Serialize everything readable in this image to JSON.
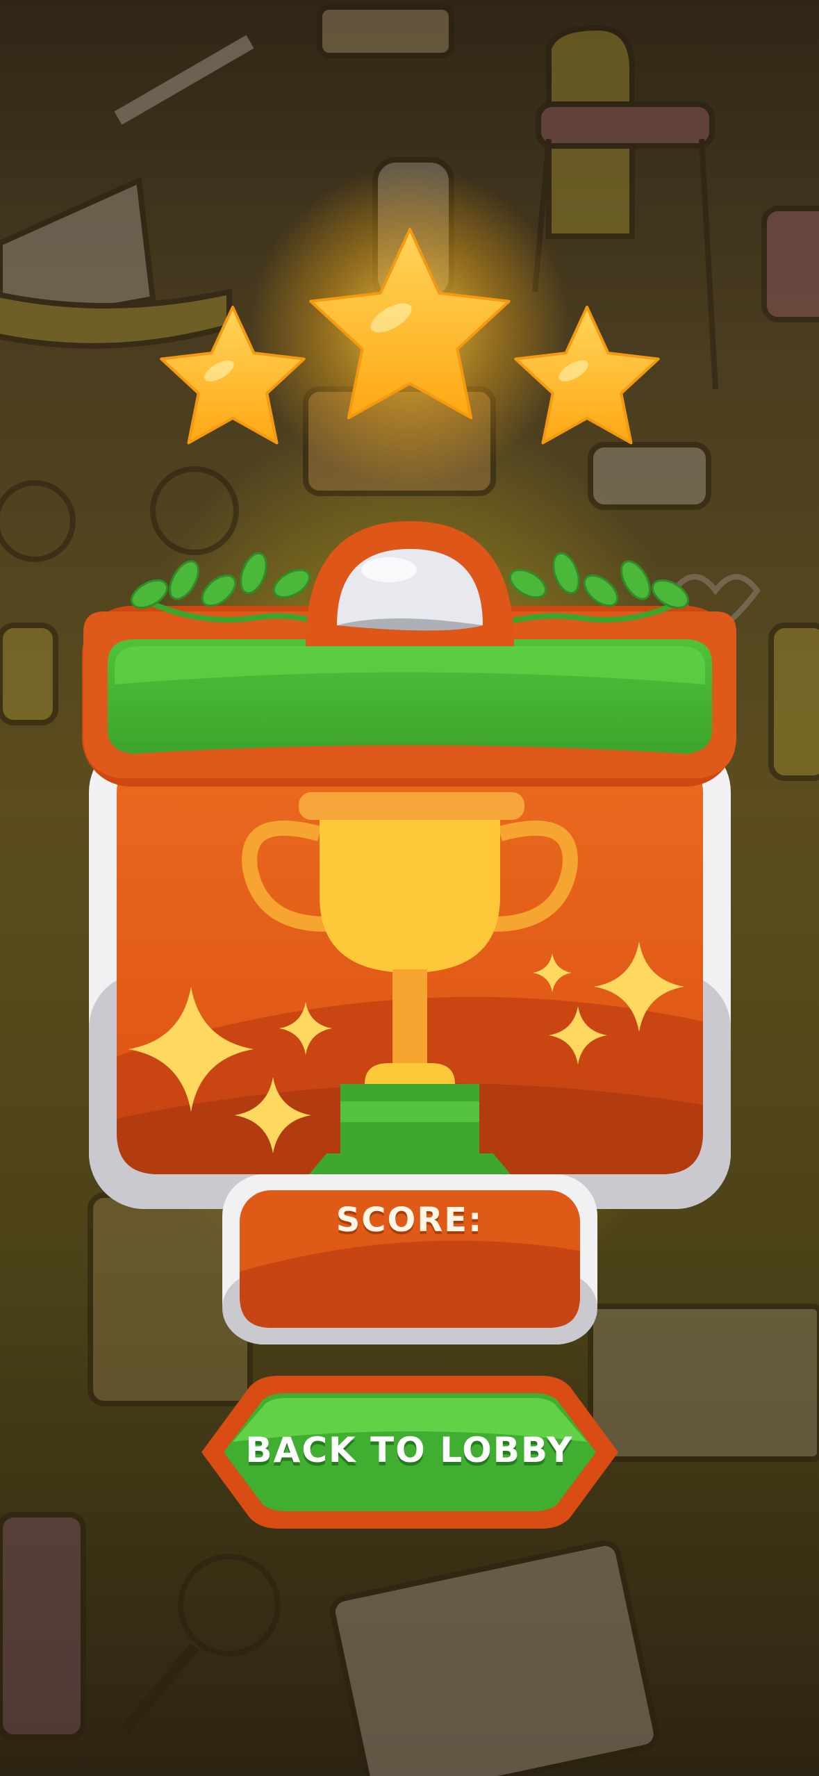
{
  "screen": "level_complete",
  "stars": {
    "earned": 3,
    "total": 3
  },
  "score": {
    "label": "SCORE:",
    "value": ""
  },
  "buttons": {
    "back_to_lobby": "BACK TO LOBBY"
  },
  "icons": [
    "star-icon",
    "trophy-icon",
    "sparkle-icon",
    "leaf-vine-icon"
  ],
  "colors": {
    "star": "#ffb11c",
    "panel_orange": "#e2581a",
    "panel_border": "#d9d9dd",
    "banner_green": "#46b634",
    "button_green": "#43b936",
    "trophy": "#ffc83a"
  }
}
